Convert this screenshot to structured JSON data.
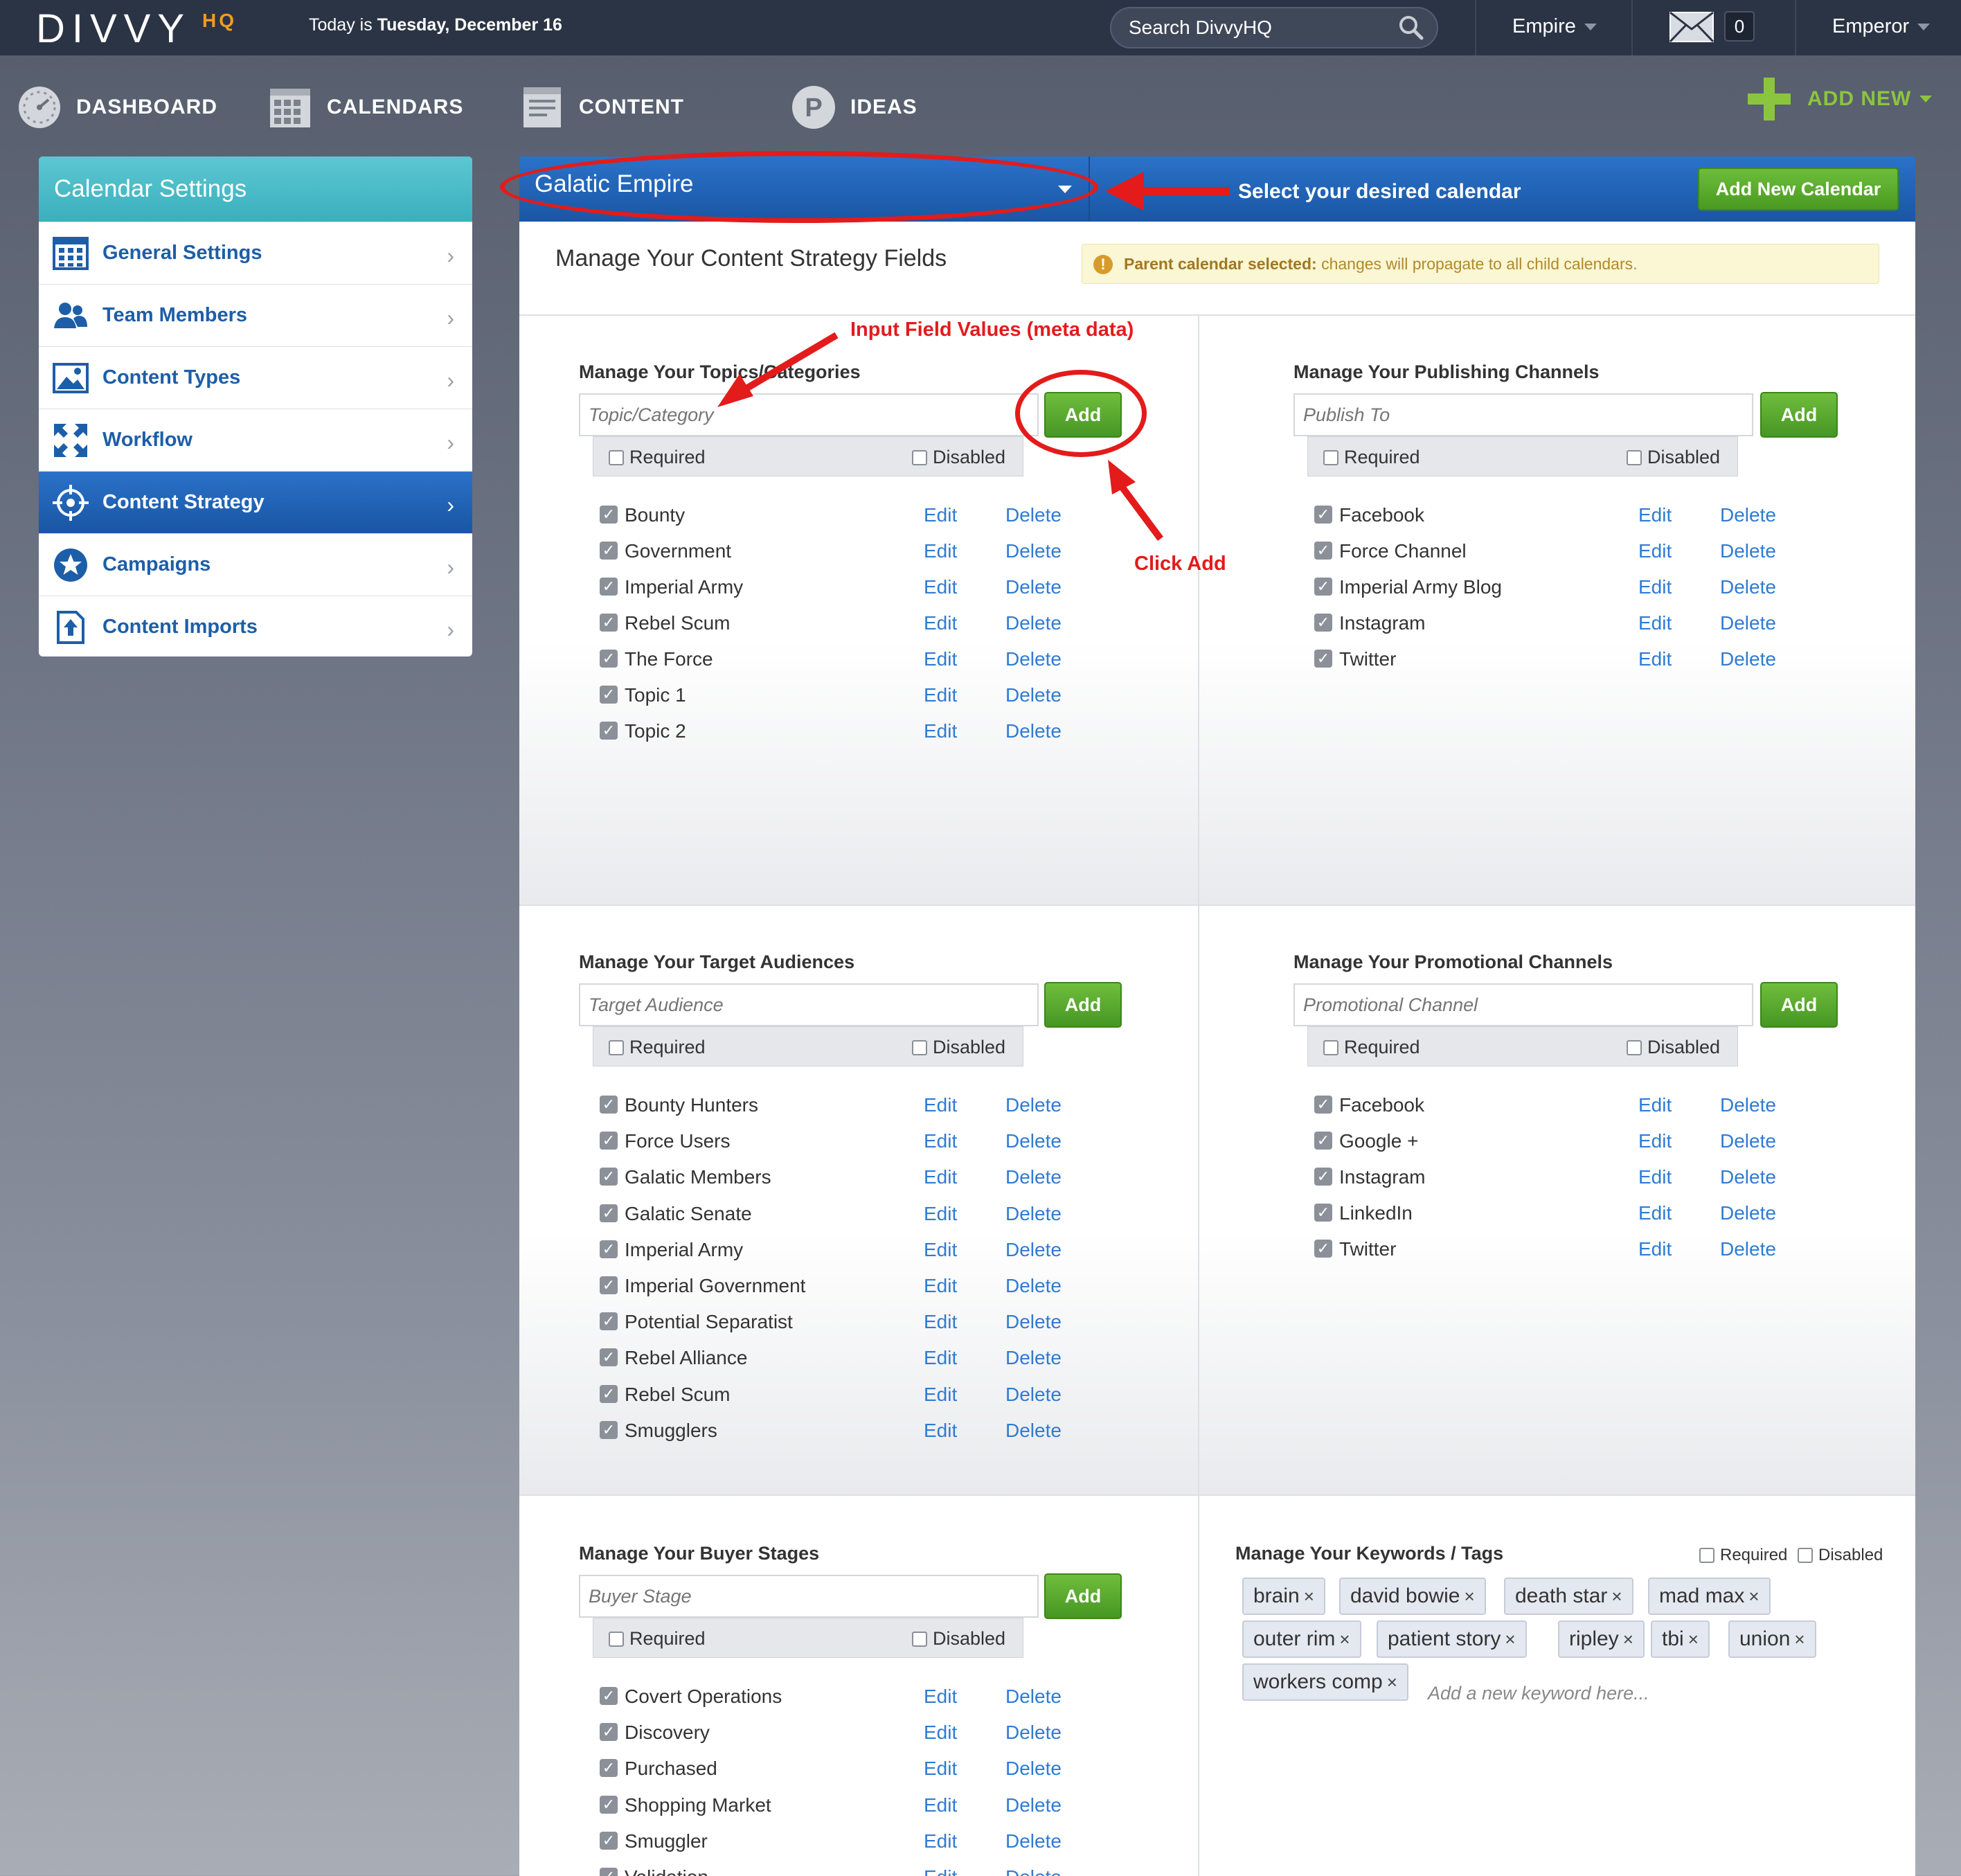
{
  "topbar": {
    "logo": "DIVVY",
    "logo_suffix": "HQ",
    "today_prefix": "Today is ",
    "today_date": "Tuesday, December 16",
    "search_placeholder": "Search DivvyHQ",
    "org_menu": "Empire",
    "message_count": "0",
    "user_menu": "Emperor"
  },
  "nav": {
    "dashboard": "DASHBOARD",
    "calendars": "CALENDARS",
    "content": "CONTENT",
    "ideas": "IDEAS",
    "add_new": "ADD NEW"
  },
  "sidebar": {
    "title": "Calendar Settings",
    "items": [
      {
        "label": "General Settings",
        "icon": "grid-icon"
      },
      {
        "label": "Team Members",
        "icon": "users-icon"
      },
      {
        "label": "Content Types",
        "icon": "image-icon"
      },
      {
        "label": "Workflow",
        "icon": "arrows-icon"
      },
      {
        "label": "Content Strategy",
        "icon": "target-icon",
        "active": true
      },
      {
        "label": "Campaigns",
        "icon": "star-icon"
      },
      {
        "label": "Content Imports",
        "icon": "import-icon"
      }
    ]
  },
  "calendar": {
    "selected": "Galatic Empire",
    "hint": "Select your desired calendar",
    "add_button": "Add New Calendar"
  },
  "page": {
    "heading": "Manage Your Content Strategy Fields",
    "notice_bold": "Parent calendar selected:",
    "notice_text": " changes will propagate to all child calendars."
  },
  "labels": {
    "add": "Add",
    "required": "Required",
    "disabled": "Disabled",
    "edit": "Edit",
    "delete": "Delete"
  },
  "sections": {
    "topics": {
      "title": "Manage Your Topics/Categories",
      "placeholder": "Topic/Category",
      "items": [
        "Bounty",
        "Government",
        "Imperial Army",
        "Rebel Scum",
        "The Force",
        "Topic 1",
        "Topic 2"
      ]
    },
    "publishing": {
      "title": "Manage Your Publishing Channels",
      "placeholder": "Publish To",
      "items": [
        "Facebook",
        "Force Channel",
        "Imperial Army Blog",
        "Instagram",
        "Twitter"
      ]
    },
    "audiences": {
      "title": "Manage Your Target Audiences",
      "placeholder": "Target Audience",
      "items": [
        "Bounty Hunters",
        "Force Users",
        "Galatic Members",
        "Galatic Senate",
        "Imperial Army",
        "Imperial Government",
        "Potential Separatist",
        "Rebel Alliance",
        "Rebel Scum",
        "Smugglers"
      ]
    },
    "promotional": {
      "title": "Manage Your Promotional Channels",
      "placeholder": "Promotional Channel",
      "items": [
        "Facebook",
        "Google +",
        "Instagram",
        "LinkedIn",
        "Twitter"
      ]
    },
    "buyer": {
      "title": "Manage Your Buyer Stages",
      "placeholder": "Buyer Stage",
      "items": [
        "Covert Operations",
        "Discovery",
        "Purchased",
        "Shopping Market",
        "Smuggler",
        "Validation"
      ]
    },
    "keywords": {
      "title": "Manage Your Keywords / Tags",
      "tags": [
        "brain",
        "david bowie",
        "death star",
        "mad max",
        "outer rim",
        "patient story",
        "ripley",
        "tbi",
        "union",
        "workers comp"
      ],
      "new_placeholder": "Add a new keyword here..."
    }
  },
  "annotations": {
    "input_values": "Input Field Values (meta data)",
    "click_add": "Click Add",
    "color": "#e41b1b"
  },
  "colors": {
    "topbar": "#2b3444",
    "accent_blue": "#1f5fae",
    "teal": "#3ab0bd",
    "green": "#4a9a22",
    "link": "#2f7bd3"
  }
}
